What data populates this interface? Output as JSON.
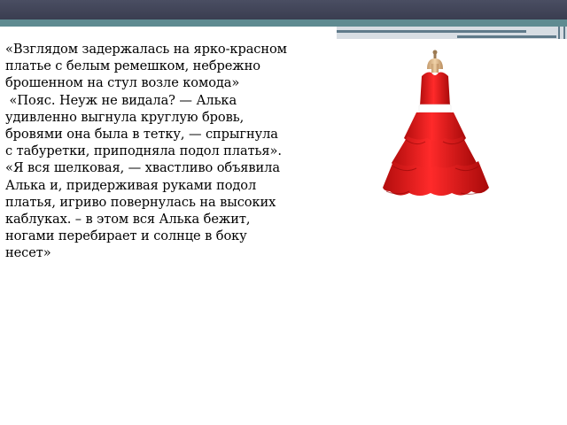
{
  "paragraphs": [
    "«Взглядом задержалась на ярко-красном платье с белым ремешком, небрежно брошенном на стул возле комода»",
    " «Пояс. Неуж не видала? — Алька удивленно выгнула круглую бровь, бровями она была в тетку, — спрыгнула с табуретки, приподняла подол платья».",
    "«Я вся шелковая, — хвастливо объявила Алька и, придерживая руками подол платья, игриво повернулась на высоких каблуках. – в этом вся Алька бежит, ногами перебирает и солнце в боку несет»"
  ],
  "colors": {
    "header_dark": "#3a3d50",
    "header_teal": "#5f8b91",
    "dress_red": "#e01a1a",
    "belt_white": "#ffffff",
    "mannequin": "#d9b48a"
  },
  "icons": {
    "dress": "red-dress-on-mannequin-icon"
  }
}
